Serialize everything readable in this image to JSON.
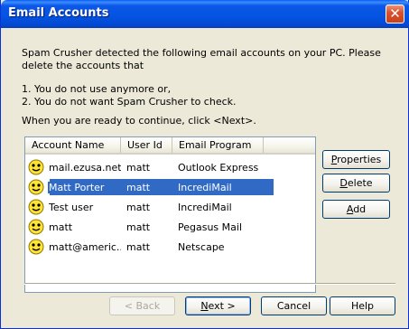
{
  "window": {
    "title": "Email Accounts",
    "close_glyph": "✕"
  },
  "intro": {
    "text": "Spam Crusher detected the following email accounts on your PC.  Please delete the accounts that",
    "line1": "1. You do not use anymore or,",
    "line2": "2. You do not want Spam Crusher to check.",
    "line3": "When you are ready to continue, click <Next>."
  },
  "list": {
    "columns": [
      "Account Name",
      "User Id",
      "Email Program",
      ""
    ],
    "rows": [
      {
        "account": "mail.ezusa.net",
        "user": "matt",
        "program": "Outlook Express",
        "selected": false
      },
      {
        "account": "Matt Porter",
        "user": "matt",
        "program": "IncrediMail",
        "selected": true
      },
      {
        "account": "Test user",
        "user": "matt",
        "program": "IncrediMail",
        "selected": false
      },
      {
        "account": "matt",
        "user": "matt",
        "program": "Pegasus Mail",
        "selected": false
      },
      {
        "account": "matt@americ...",
        "user": "matt",
        "program": "Netscape",
        "selected": false
      }
    ],
    "row_icon": "smiley-face-icon"
  },
  "side_buttons": {
    "properties": "Properties",
    "delete": "Delete",
    "add": "Add"
  },
  "bottom_buttons": {
    "back": "< Back",
    "next": "Next >",
    "cancel": "Cancel",
    "help": "Help"
  },
  "colors": {
    "title_bar": "#0553e0",
    "selection": "#316ac5",
    "face": "#ece9d8"
  }
}
